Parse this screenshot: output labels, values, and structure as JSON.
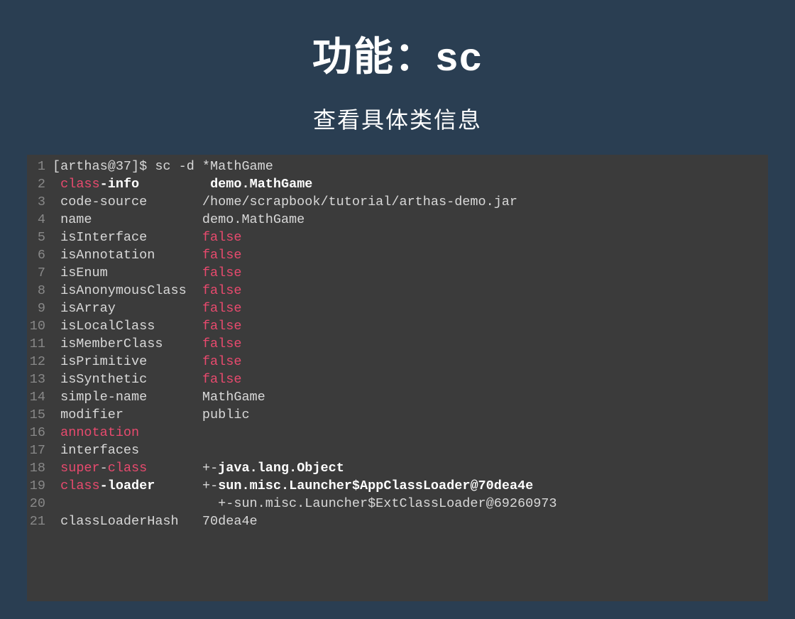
{
  "title": "功能：sc",
  "subtitle": "查看具体类信息",
  "code": {
    "lines": [
      {
        "n": "1",
        "segs": [
          {
            "t": "[arthas@37]$ sc -d *MathGame",
            "c": ""
          }
        ]
      },
      {
        "n": "2",
        "segs": [
          {
            "t": " ",
            "c": ""
          },
          {
            "t": "class",
            "c": "kw"
          },
          {
            "t": "-",
            "c": "bold"
          },
          {
            "t": "info",
            "c": "bold"
          },
          {
            "t": "         ",
            "c": ""
          },
          {
            "t": "demo.MathGame",
            "c": "bold"
          }
        ]
      },
      {
        "n": "3",
        "segs": [
          {
            "t": " code-source       /home/scrapbook/tutorial/arthas-demo.jar",
            "c": ""
          }
        ]
      },
      {
        "n": "4",
        "segs": [
          {
            "t": " name              demo.MathGame",
            "c": ""
          }
        ]
      },
      {
        "n": "5",
        "segs": [
          {
            "t": " isInterface       ",
            "c": ""
          },
          {
            "t": "false",
            "c": "val-false"
          }
        ]
      },
      {
        "n": "6",
        "segs": [
          {
            "t": " isAnnotation      ",
            "c": ""
          },
          {
            "t": "false",
            "c": "val-false"
          }
        ]
      },
      {
        "n": "7",
        "segs": [
          {
            "t": " isEnum            ",
            "c": ""
          },
          {
            "t": "false",
            "c": "val-false"
          }
        ]
      },
      {
        "n": "8",
        "segs": [
          {
            "t": " isAnonymousClass  ",
            "c": ""
          },
          {
            "t": "false",
            "c": "val-false"
          }
        ]
      },
      {
        "n": "9",
        "segs": [
          {
            "t": " isArray           ",
            "c": ""
          },
          {
            "t": "false",
            "c": "val-false"
          }
        ]
      },
      {
        "n": "10",
        "segs": [
          {
            "t": " isLocalClass      ",
            "c": ""
          },
          {
            "t": "false",
            "c": "val-false"
          }
        ]
      },
      {
        "n": "11",
        "segs": [
          {
            "t": " isMemberClass     ",
            "c": ""
          },
          {
            "t": "false",
            "c": "val-false"
          }
        ]
      },
      {
        "n": "12",
        "segs": [
          {
            "t": " isPrimitive       ",
            "c": ""
          },
          {
            "t": "false",
            "c": "val-false"
          }
        ]
      },
      {
        "n": "13",
        "segs": [
          {
            "t": " isSynthetic       ",
            "c": ""
          },
          {
            "t": "false",
            "c": "val-false"
          }
        ]
      },
      {
        "n": "14",
        "segs": [
          {
            "t": " simple-name       MathGame",
            "c": ""
          }
        ]
      },
      {
        "n": "15",
        "segs": [
          {
            "t": " modifier          public",
            "c": ""
          }
        ]
      },
      {
        "n": "16",
        "segs": [
          {
            "t": " ",
            "c": ""
          },
          {
            "t": "annotation",
            "c": "kw"
          }
        ]
      },
      {
        "n": "17",
        "segs": [
          {
            "t": " interfaces",
            "c": ""
          }
        ]
      },
      {
        "n": "18",
        "segs": [
          {
            "t": " ",
            "c": ""
          },
          {
            "t": "super",
            "c": "kw"
          },
          {
            "t": "-",
            "c": ""
          },
          {
            "t": "class",
            "c": "kw"
          },
          {
            "t": "       +-",
            "c": ""
          },
          {
            "t": "java.lang.Object",
            "c": "bold"
          }
        ]
      },
      {
        "n": "19",
        "segs": [
          {
            "t": " ",
            "c": ""
          },
          {
            "t": "class",
            "c": "kw"
          },
          {
            "t": "-",
            "c": "bold"
          },
          {
            "t": "loader",
            "c": "bold"
          },
          {
            "t": "      +-",
            "c": ""
          },
          {
            "t": "sun.misc.Launcher$AppClassLoader@70dea4e",
            "c": "bold"
          }
        ]
      },
      {
        "n": "20",
        "segs": [
          {
            "t": "                     +-sun.misc.Launcher$ExtClassLoader@69260973",
            "c": ""
          }
        ]
      },
      {
        "n": "21",
        "segs": [
          {
            "t": " classLoaderHash   70dea4e",
            "c": ""
          }
        ]
      }
    ]
  }
}
